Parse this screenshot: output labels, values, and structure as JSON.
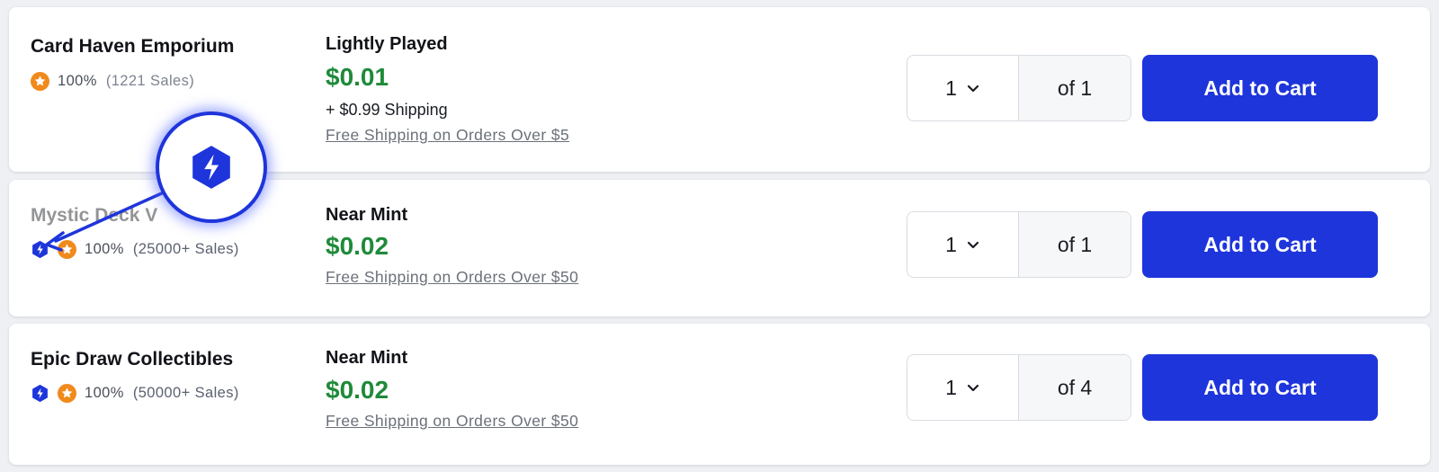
{
  "colors": {
    "accent": "#1e35db",
    "price_green": "#1f8a3a",
    "rating_orange": "#f08a1c"
  },
  "listings": [
    {
      "seller": "Card Haven Emporium",
      "rating": "100%",
      "sales": "(1221 Sales)",
      "condition": "Lightly Played",
      "price": "$0.01",
      "shipping": "+ $0.99 Shipping",
      "free_shipping": "Free Shipping on Orders Over $5",
      "quantity": "1",
      "available": "of 1",
      "button": "Add to Cart",
      "badges": [
        "star-badge-icon"
      ]
    },
    {
      "seller": "Mystic Deck V",
      "rating": "100%",
      "sales": "(25000+ Sales)",
      "condition": "Near Mint",
      "price": "$0.02",
      "free_shipping": "Free Shipping on Orders Over $50",
      "quantity": "1",
      "available": "of 1",
      "button": "Add to Cart",
      "badges": [
        "direct-seller-icon",
        "star-badge-icon"
      ]
    },
    {
      "seller": "Epic Draw Collectibles",
      "rating": "100%",
      "sales": "(50000+ Sales)",
      "condition": "Near Mint",
      "price": "$0.02",
      "free_shipping": "Free Shipping on Orders Over $50",
      "quantity": "1",
      "available": "of 4",
      "button": "Add to Cart",
      "badges": [
        "direct-seller-icon",
        "star-badge-icon"
      ]
    }
  ],
  "callout": {
    "icon": "direct-seller-icon",
    "points_to": "listing 2 direct seller badge"
  }
}
